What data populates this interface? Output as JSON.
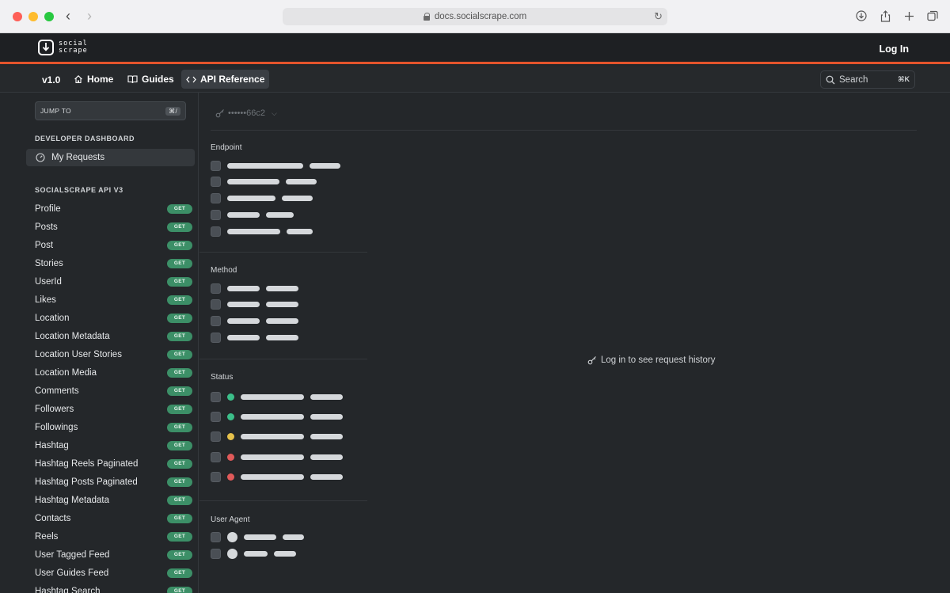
{
  "browser": {
    "url": "docs.socialscrape.com"
  },
  "header": {
    "logo_line1": "social",
    "logo_line2": "scrape",
    "login": "Log In",
    "accent_color": "#e4542c"
  },
  "subnav": {
    "version": "v1.0",
    "home": "Home",
    "guides": "Guides",
    "api_reference": "API Reference",
    "search_placeholder": "Search",
    "search_shortcut": "⌘K"
  },
  "sidebar": {
    "jump_label": "JUMP TO",
    "jump_shortcut": "⌘/",
    "dashboard_title": "DEVELOPER DASHBOARD",
    "my_requests": "My Requests",
    "api_title": "SOCIALSCRAPE API V3",
    "badge_label": "GET",
    "badge_color": "#3c8f67",
    "items": [
      "Profile",
      "Posts",
      "Post",
      "Stories",
      "UserId",
      "Likes",
      "Location",
      "Location Metadata",
      "Location User Stories",
      "Location Media",
      "Comments",
      "Followers",
      "Followings",
      "Hashtag",
      "Hashtag Reels Paginated",
      "Hashtag Posts Paginated",
      "Hashtag Metadata",
      "Contacts",
      "Reels",
      "User Tagged Feed",
      "User Guides Feed",
      "Hashtag Search"
    ]
  },
  "main": {
    "api_key": "••••••66c2",
    "filters": {
      "endpoint": "Endpoint",
      "method": "Method",
      "status": "Status",
      "user_agent": "User Agent"
    },
    "status_colors": [
      "#3cbf8a",
      "#3cbf8a",
      "#e6c14b",
      "#e05a5a",
      "#e05a5a"
    ],
    "empty_message": "Log in to see request history"
  }
}
